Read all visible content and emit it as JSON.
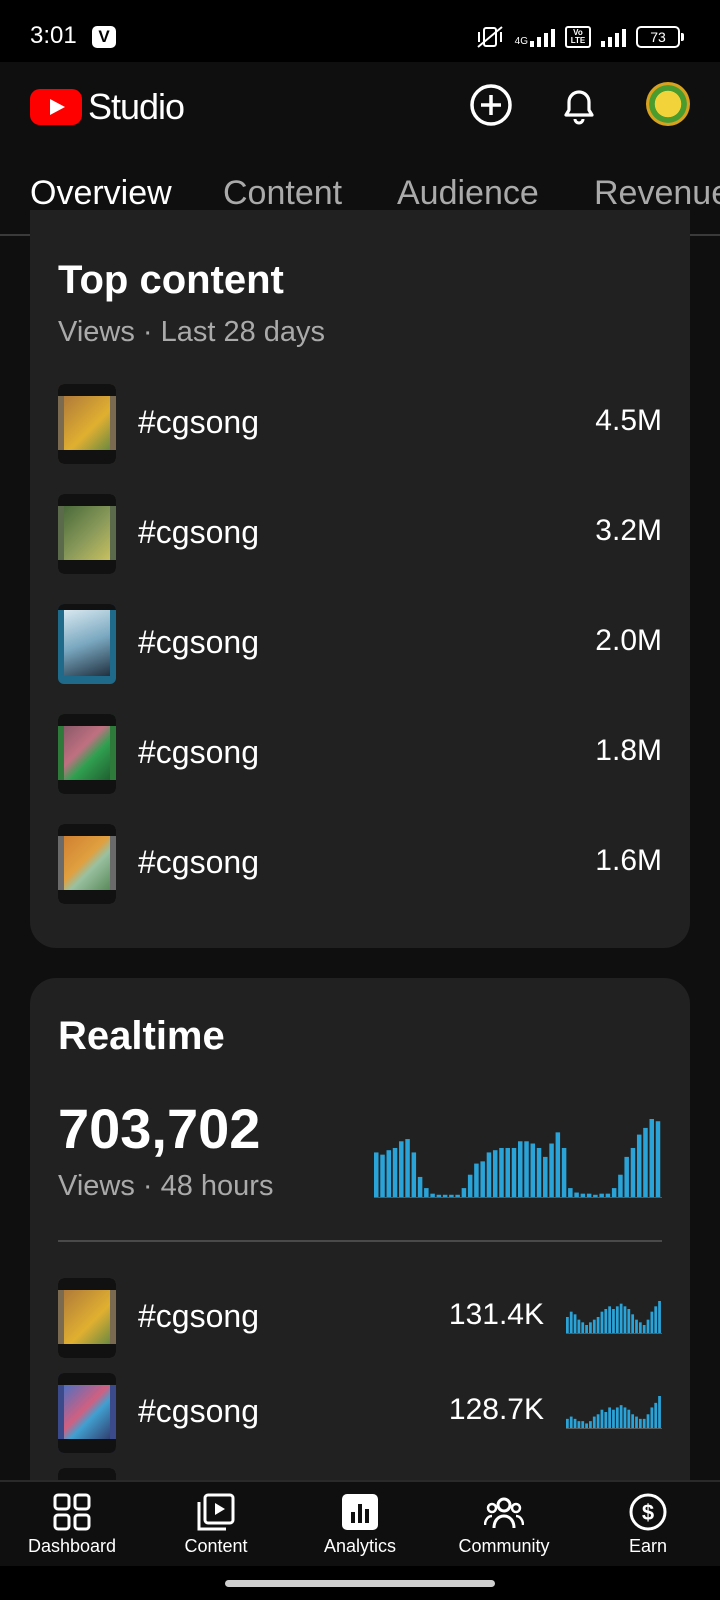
{
  "status_bar": {
    "time": "3:01",
    "app_icon": "V",
    "network": "4G",
    "volte": "Vo LTE",
    "battery": "73"
  },
  "header": {
    "app_name": "Studio"
  },
  "tabs": [
    {
      "label": "Overview"
    },
    {
      "label": "Content"
    },
    {
      "label": "Audience"
    },
    {
      "label": "Revenue"
    }
  ],
  "top_content": {
    "title": "Top content",
    "subtitle": "Views · Last 28 days",
    "items": [
      {
        "title": "#cgsong",
        "views": "4.5M"
      },
      {
        "title": "#cgsong",
        "views": "3.2M"
      },
      {
        "title": "#cgsong",
        "views": "2.0M"
      },
      {
        "title": "#cgsong",
        "views": "1.8M"
      },
      {
        "title": "#cgsong",
        "views": "1.6M"
      }
    ]
  },
  "realtime": {
    "title": "Realtime",
    "total_views": "703,702",
    "subtitle": "Views · 48 hours",
    "bar_color": "#2aa3d8",
    "chart_values": [
      40,
      38,
      42,
      44,
      50,
      52,
      40,
      18,
      8,
      3,
      2,
      2,
      2,
      2,
      8,
      20,
      30,
      32,
      40,
      42,
      44,
      44,
      44,
      50,
      50,
      48,
      44,
      36,
      48,
      58,
      44,
      8,
      4,
      3,
      3,
      2,
      3,
      3,
      8,
      20,
      36,
      44,
      56,
      62,
      70,
      68
    ],
    "items": [
      {
        "title": "#cgsong",
        "views": "131.4K",
        "spark": [
          6,
          8,
          7,
          5,
          4,
          3,
          4,
          5,
          6,
          8,
          9,
          10,
          9,
          10,
          11,
          10,
          9,
          7,
          5,
          4,
          3,
          5,
          8,
          10,
          12
        ]
      },
      {
        "title": "#cgsong",
        "views": "128.7K",
        "spark": [
          4,
          5,
          4,
          3,
          3,
          2,
          3,
          5,
          6,
          8,
          7,
          9,
          8,
          9,
          10,
          9,
          8,
          6,
          5,
          4,
          4,
          6,
          9,
          11,
          14
        ]
      }
    ]
  },
  "bottom_nav": [
    {
      "label": "Dashboard",
      "icon": "dashboard-icon"
    },
    {
      "label": "Content",
      "icon": "content-icon"
    },
    {
      "label": "Analytics",
      "icon": "analytics-icon"
    },
    {
      "label": "Community",
      "icon": "community-icon"
    },
    {
      "label": "Earn",
      "icon": "earn-icon"
    }
  ]
}
